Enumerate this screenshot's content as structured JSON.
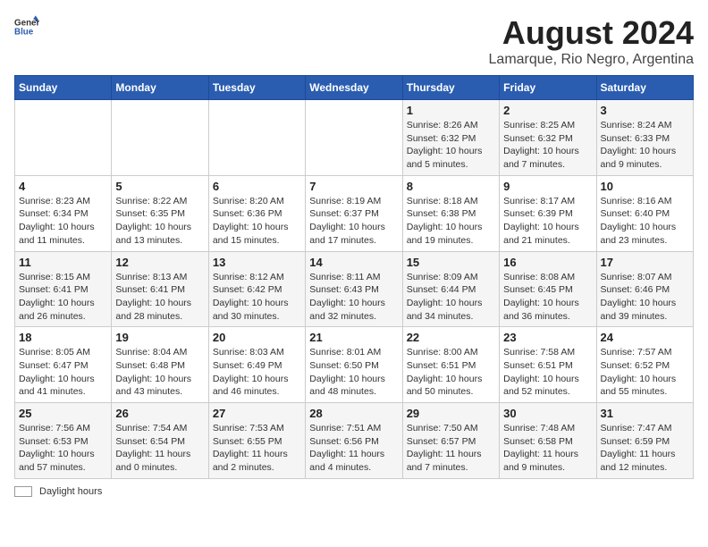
{
  "header": {
    "logo_line1": "General",
    "logo_line2": "Blue",
    "main_title": "August 2024",
    "subtitle": "Lamarque, Rio Negro, Argentina"
  },
  "days_of_week": [
    "Sunday",
    "Monday",
    "Tuesday",
    "Wednesday",
    "Thursday",
    "Friday",
    "Saturday"
  ],
  "weeks": [
    [
      {
        "day": "",
        "detail": ""
      },
      {
        "day": "",
        "detail": ""
      },
      {
        "day": "",
        "detail": ""
      },
      {
        "day": "",
        "detail": ""
      },
      {
        "day": "1",
        "detail": "Sunrise: 8:26 AM\nSunset: 6:32 PM\nDaylight: 10 hours\nand 5 minutes."
      },
      {
        "day": "2",
        "detail": "Sunrise: 8:25 AM\nSunset: 6:32 PM\nDaylight: 10 hours\nand 7 minutes."
      },
      {
        "day": "3",
        "detail": "Sunrise: 8:24 AM\nSunset: 6:33 PM\nDaylight: 10 hours\nand 9 minutes."
      }
    ],
    [
      {
        "day": "4",
        "detail": "Sunrise: 8:23 AM\nSunset: 6:34 PM\nDaylight: 10 hours\nand 11 minutes."
      },
      {
        "day": "5",
        "detail": "Sunrise: 8:22 AM\nSunset: 6:35 PM\nDaylight: 10 hours\nand 13 minutes."
      },
      {
        "day": "6",
        "detail": "Sunrise: 8:20 AM\nSunset: 6:36 PM\nDaylight: 10 hours\nand 15 minutes."
      },
      {
        "day": "7",
        "detail": "Sunrise: 8:19 AM\nSunset: 6:37 PM\nDaylight: 10 hours\nand 17 minutes."
      },
      {
        "day": "8",
        "detail": "Sunrise: 8:18 AM\nSunset: 6:38 PM\nDaylight: 10 hours\nand 19 minutes."
      },
      {
        "day": "9",
        "detail": "Sunrise: 8:17 AM\nSunset: 6:39 PM\nDaylight: 10 hours\nand 21 minutes."
      },
      {
        "day": "10",
        "detail": "Sunrise: 8:16 AM\nSunset: 6:40 PM\nDaylight: 10 hours\nand 23 minutes."
      }
    ],
    [
      {
        "day": "11",
        "detail": "Sunrise: 8:15 AM\nSunset: 6:41 PM\nDaylight: 10 hours\nand 26 minutes."
      },
      {
        "day": "12",
        "detail": "Sunrise: 8:13 AM\nSunset: 6:41 PM\nDaylight: 10 hours\nand 28 minutes."
      },
      {
        "day": "13",
        "detail": "Sunrise: 8:12 AM\nSunset: 6:42 PM\nDaylight: 10 hours\nand 30 minutes."
      },
      {
        "day": "14",
        "detail": "Sunrise: 8:11 AM\nSunset: 6:43 PM\nDaylight: 10 hours\nand 32 minutes."
      },
      {
        "day": "15",
        "detail": "Sunrise: 8:09 AM\nSunset: 6:44 PM\nDaylight: 10 hours\nand 34 minutes."
      },
      {
        "day": "16",
        "detail": "Sunrise: 8:08 AM\nSunset: 6:45 PM\nDaylight: 10 hours\nand 36 minutes."
      },
      {
        "day": "17",
        "detail": "Sunrise: 8:07 AM\nSunset: 6:46 PM\nDaylight: 10 hours\nand 39 minutes."
      }
    ],
    [
      {
        "day": "18",
        "detail": "Sunrise: 8:05 AM\nSunset: 6:47 PM\nDaylight: 10 hours\nand 41 minutes."
      },
      {
        "day": "19",
        "detail": "Sunrise: 8:04 AM\nSunset: 6:48 PM\nDaylight: 10 hours\nand 43 minutes."
      },
      {
        "day": "20",
        "detail": "Sunrise: 8:03 AM\nSunset: 6:49 PM\nDaylight: 10 hours\nand 46 minutes."
      },
      {
        "day": "21",
        "detail": "Sunrise: 8:01 AM\nSunset: 6:50 PM\nDaylight: 10 hours\nand 48 minutes."
      },
      {
        "day": "22",
        "detail": "Sunrise: 8:00 AM\nSunset: 6:51 PM\nDaylight: 10 hours\nand 50 minutes."
      },
      {
        "day": "23",
        "detail": "Sunrise: 7:58 AM\nSunset: 6:51 PM\nDaylight: 10 hours\nand 52 minutes."
      },
      {
        "day": "24",
        "detail": "Sunrise: 7:57 AM\nSunset: 6:52 PM\nDaylight: 10 hours\nand 55 minutes."
      }
    ],
    [
      {
        "day": "25",
        "detail": "Sunrise: 7:56 AM\nSunset: 6:53 PM\nDaylight: 10 hours\nand 57 minutes."
      },
      {
        "day": "26",
        "detail": "Sunrise: 7:54 AM\nSunset: 6:54 PM\nDaylight: 11 hours\nand 0 minutes."
      },
      {
        "day": "27",
        "detail": "Sunrise: 7:53 AM\nSunset: 6:55 PM\nDaylight: 11 hours\nand 2 minutes."
      },
      {
        "day": "28",
        "detail": "Sunrise: 7:51 AM\nSunset: 6:56 PM\nDaylight: 11 hours\nand 4 minutes."
      },
      {
        "day": "29",
        "detail": "Sunrise: 7:50 AM\nSunset: 6:57 PM\nDaylight: 11 hours\nand 7 minutes."
      },
      {
        "day": "30",
        "detail": "Sunrise: 7:48 AM\nSunset: 6:58 PM\nDaylight: 11 hours\nand 9 minutes."
      },
      {
        "day": "31",
        "detail": "Sunrise: 7:47 AM\nSunset: 6:59 PM\nDaylight: 11 hours\nand 12 minutes."
      }
    ]
  ],
  "footer": {
    "legend_label": "Daylight hours"
  }
}
